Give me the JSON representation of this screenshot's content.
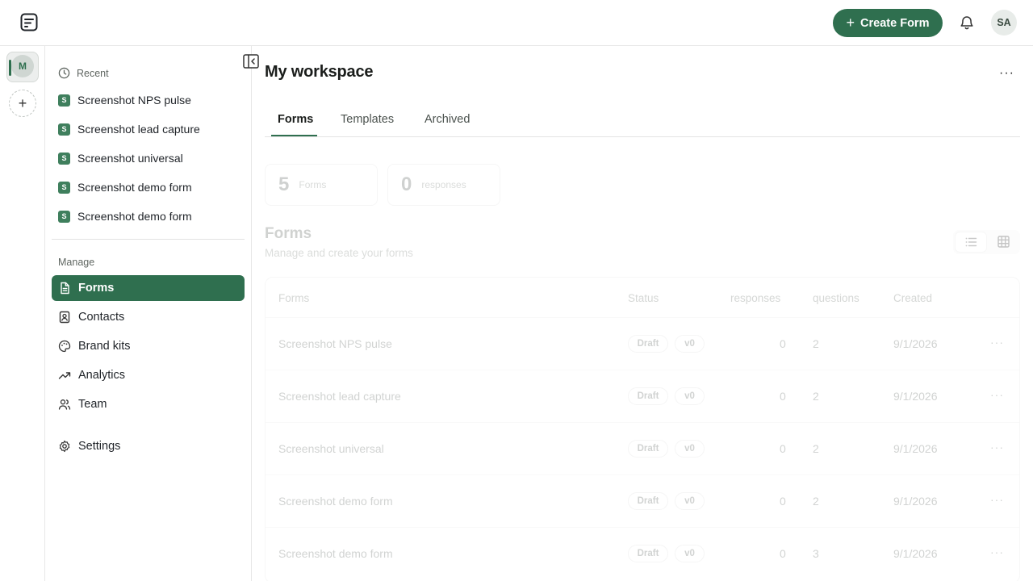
{
  "header": {
    "create_label": "Create Form",
    "avatar_initials": "SA"
  },
  "rail": {
    "workspace_initial": "M",
    "add_label": "+"
  },
  "sidebar": {
    "recent_title": "Recent",
    "recent_badge": "S",
    "recent": [
      "Screenshot NPS pulse",
      "Screenshot lead capture",
      "Screenshot universal",
      "Screenshot demo form",
      "Screenshot demo form"
    ],
    "manage_title": "Manage",
    "nav": [
      {
        "label": "Forms",
        "icon": "file-text-icon",
        "active": true
      },
      {
        "label": "Contacts",
        "icon": "contact-icon",
        "active": false
      },
      {
        "label": "Brand kits",
        "icon": "palette-icon",
        "active": false
      },
      {
        "label": "Analytics",
        "icon": "trending-icon",
        "active": false
      },
      {
        "label": "Team",
        "icon": "users-icon",
        "active": false
      }
    ],
    "settings_label": "Settings"
  },
  "main": {
    "title": "My workspace",
    "more": "···",
    "tabs": [
      {
        "label": "Forms",
        "active": true
      },
      {
        "label": "Templates",
        "active": false
      },
      {
        "label": "Archived",
        "active": false
      }
    ],
    "stats": [
      {
        "value": "5",
        "label": "Forms"
      },
      {
        "value": "0",
        "label": "responses"
      }
    ],
    "section_title": "Forms",
    "section_subtitle": "Manage and create your forms",
    "table": {
      "columns": [
        "Forms",
        "Status",
        "responses",
        "questions",
        "Created"
      ],
      "rows": [
        {
          "name": "Screenshot NPS pulse",
          "status": "Draft",
          "version": "v0",
          "responses": "0",
          "questions": "2",
          "created": "9/1/2026"
        },
        {
          "name": "Screenshot lead capture",
          "status": "Draft",
          "version": "v0",
          "responses": "0",
          "questions": "2",
          "created": "9/1/2026"
        },
        {
          "name": "Screenshot universal",
          "status": "Draft",
          "version": "v0",
          "responses": "0",
          "questions": "2",
          "created": "9/1/2026"
        },
        {
          "name": "Screenshot demo form",
          "status": "Draft",
          "version": "v0",
          "responses": "0",
          "questions": "2",
          "created": "9/1/2026"
        },
        {
          "name": "Screenshot demo form",
          "status": "Draft",
          "version": "v0",
          "responses": "0",
          "questions": "3",
          "created": "9/1/2026"
        }
      ],
      "row_more": "···"
    }
  },
  "colors": {
    "accent": "#2f6f4f",
    "border": "#e7e7e7"
  }
}
